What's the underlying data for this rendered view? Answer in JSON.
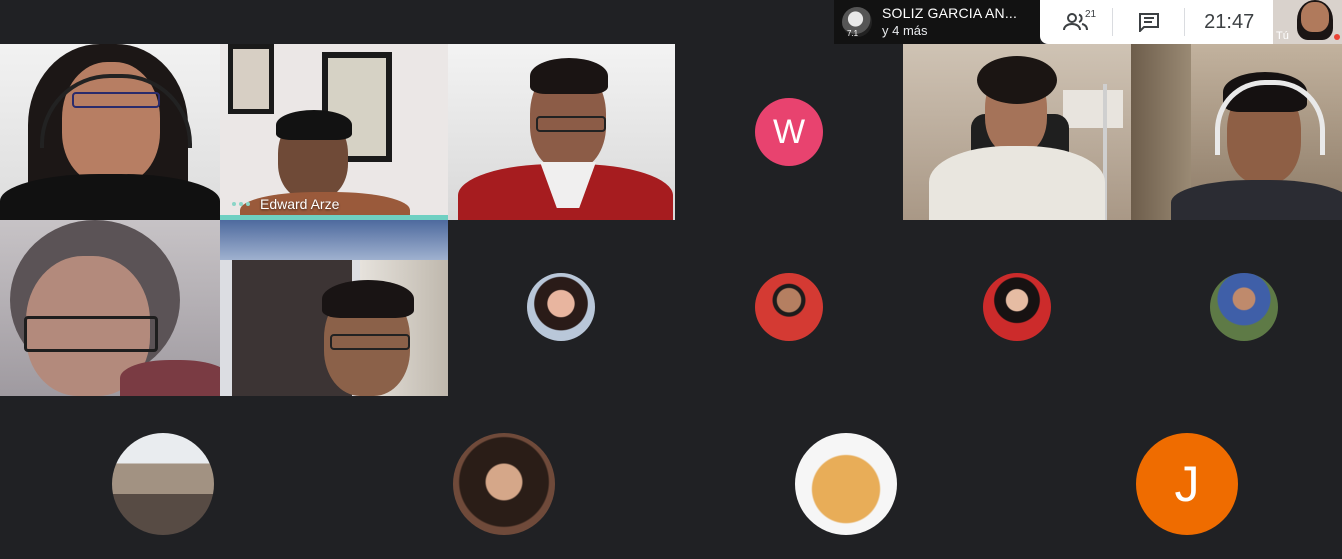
{
  "topbar": {
    "presenter_name": "SOLIZ GARCIA AN...",
    "presenter_sub": "y 4 más",
    "presenter_badge": "7.1",
    "participants_count": "21",
    "clock": "21:47",
    "self_label": "Tú"
  },
  "tiles": {
    "speaker_name": "Edward Arze"
  },
  "avatars": {
    "w_letter": "W",
    "j_letter": "J"
  },
  "colors": {
    "background": "#202124",
    "speaker_accent": "#6fd0c2",
    "avatar_w": "#e8436f",
    "avatar_j": "#ef6c00"
  },
  "icons": [
    "people-icon",
    "chat-icon"
  ]
}
